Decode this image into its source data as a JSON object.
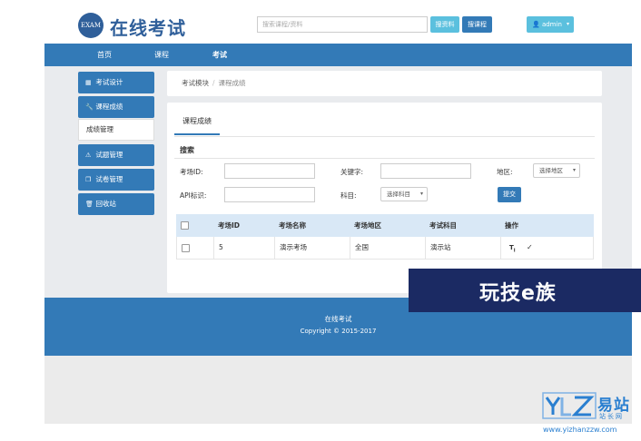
{
  "header": {
    "logo_badge": "EXAM",
    "app_title": "在线考试",
    "search": {
      "placeholder": "搜索课程/资料"
    },
    "search_material_label": "搜资料",
    "search_course_label": "搜课程",
    "user_label": "admin"
  },
  "nav": {
    "items": [
      {
        "label": "首页"
      },
      {
        "label": "课程"
      },
      {
        "label": "考试"
      }
    ]
  },
  "sidebar": {
    "items": [
      {
        "label": "考试设计"
      },
      {
        "label": "课程成绩"
      },
      {
        "label": "成绩管理"
      },
      {
        "label": "试题管理"
      },
      {
        "label": "试卷管理"
      },
      {
        "label": "回收站"
      }
    ]
  },
  "breadcrumb": {
    "root": "考试模块",
    "separator": "/",
    "current": "课程成绩"
  },
  "main": {
    "tab_label": "课程成绩",
    "search_title": "搜索",
    "fields": {
      "exam_id_label": "考场ID:",
      "keyword_label": "关键字:",
      "region_label": "地区:",
      "region_select": "选择地区",
      "api_label": "API标识:",
      "subject_label": "科目:",
      "subject_select": "选择科目",
      "submit_label": "提交"
    },
    "table": {
      "headers": [
        "考场ID",
        "考场名称",
        "考场地区",
        "考试科目",
        "操作"
      ],
      "rows": [
        {
          "id": "5",
          "name": "演示考场",
          "region": "全国",
          "subject": "演示站"
        }
      ]
    }
  },
  "footer": {
    "title": "在线考试",
    "copyright": "Copyright © 2015-2017"
  },
  "watermark": {
    "banner_text": "玩技e族",
    "site_cn": "易站",
    "site_sub": "站长网",
    "url": "www.yizhanzzw.com"
  }
}
